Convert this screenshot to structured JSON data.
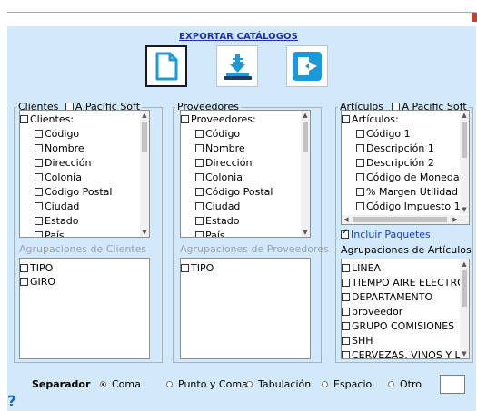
{
  "title": "EXPORTAR CATÁLOGOS",
  "toolbar": {
    "icons": [
      "document-icon",
      "download-tray-icon",
      "exit-icon"
    ],
    "accent": "#1a9ad8"
  },
  "clientes": {
    "legend": "Clientes",
    "apacific": "A Pacific Soft",
    "items": [
      "Clientes:",
      "Código",
      "Nombre",
      "Dirección",
      "Colonia",
      "Código Postal",
      "Ciudad",
      "Estado",
      "País"
    ],
    "agrup_label": "Agrupaciones de Clientes",
    "agrup": [
      "TIPO",
      "GIRO"
    ]
  },
  "proveedores": {
    "legend": "Proveedores",
    "items": [
      "Proveedores:",
      "Código",
      "Nombre",
      "Dirección",
      "Colonia",
      "Código Postal",
      "Ciudad",
      "Estado",
      "País"
    ],
    "agrup_label": "Agrupaciones de Proveedores",
    "agrup": [
      "TIPO"
    ]
  },
  "articulos": {
    "legend": "Artículos",
    "apacific": "A Pacific Soft",
    "items": [
      "Artículos:",
      "Código 1",
      "Descripción 1",
      "Descripción 2",
      "Código de Moneda",
      "% Margen Utilidad",
      "Código Impuesto 1"
    ],
    "incluir_paquetes": "Incluir Paquetes",
    "agrup_label": "Agrupaciones de Artículos",
    "agrup": [
      "LINEA",
      "TIEMPO AIRE ELECTRONI",
      "DEPARTAMENTO",
      "proveedor",
      "GRUPO COMISIONES",
      "SHH",
      "CERVEZAS, VINOS Y LICO"
    ]
  },
  "separator": {
    "label": "Separador",
    "options": [
      "Coma",
      "Punto y Coma",
      "Tabulación",
      "Espacio",
      "Otro"
    ],
    "selected": "Coma",
    "otro_value": ""
  },
  "help": "?"
}
